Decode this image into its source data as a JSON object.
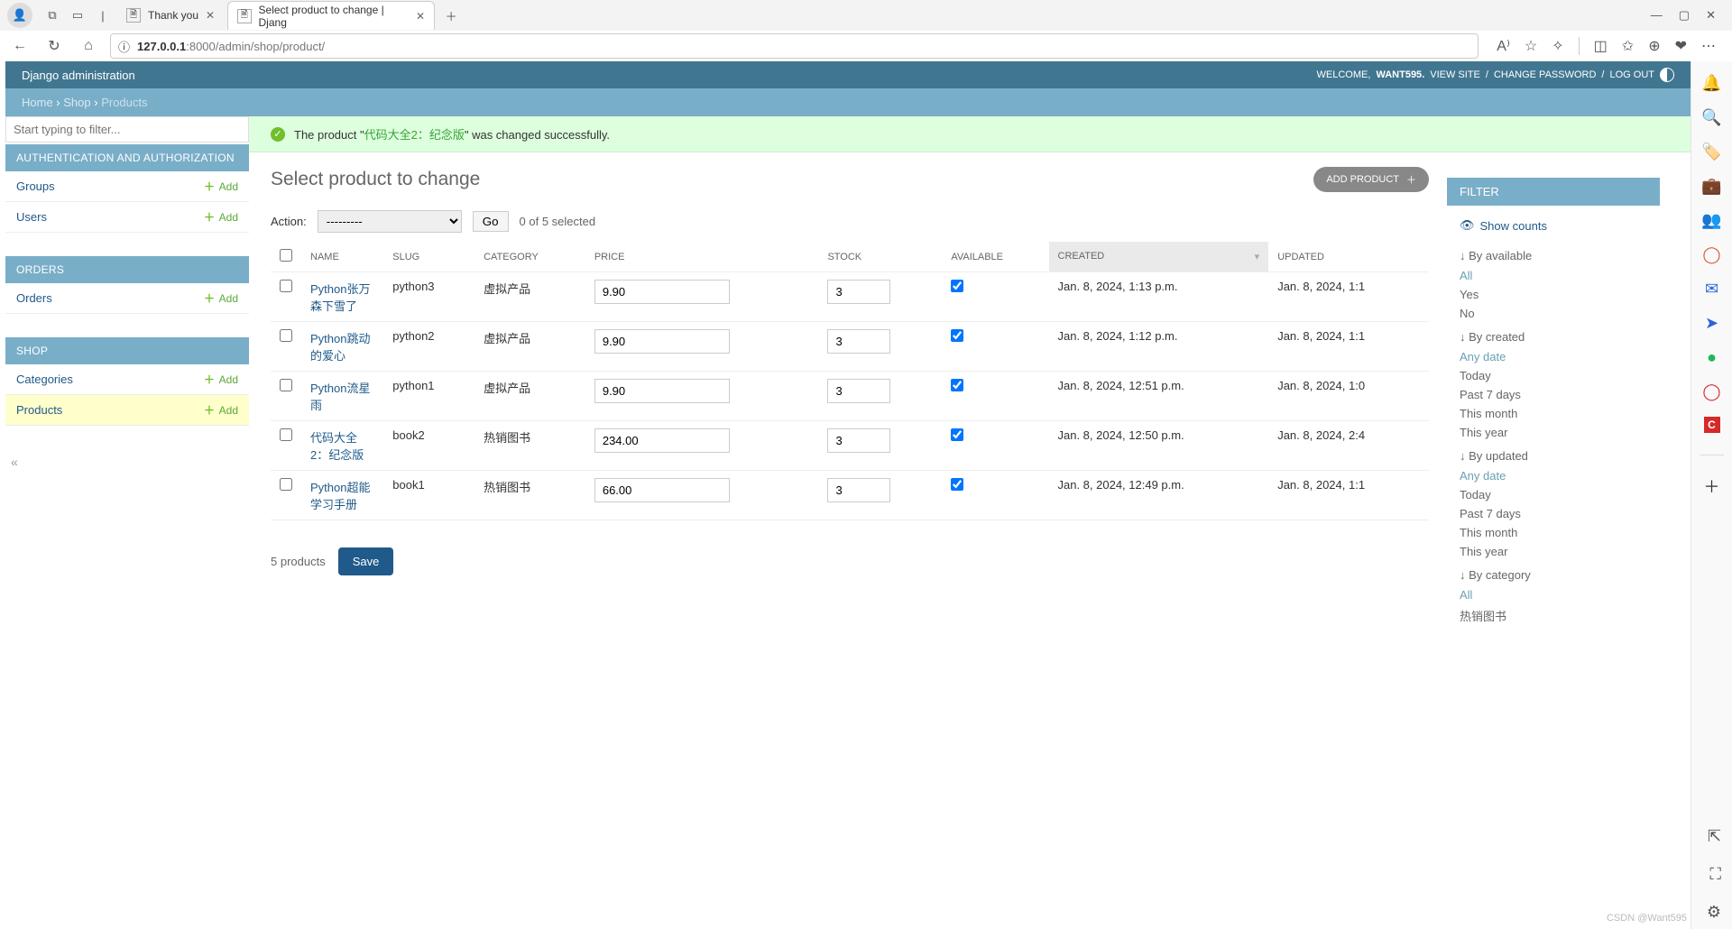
{
  "browser": {
    "tabs": [
      {
        "title": "Thank you",
        "active": false
      },
      {
        "title": "Select product to change | Djang",
        "active": true
      }
    ],
    "url": "127.0.0.1:8000/admin/shop/product/",
    "url_prefix": "127.0.0.1",
    "url_rest": ":8000/admin/shop/product/"
  },
  "header": {
    "site_title": "Django administration",
    "welcome": "WELCOME,",
    "username": "WANT595",
    "links": {
      "view_site": "VIEW SITE",
      "change_password": "CHANGE PASSWORD",
      "logout": "LOG OUT"
    }
  },
  "breadcrumbs": {
    "home": "Home",
    "shop": "Shop",
    "products": "Products"
  },
  "sidebar": {
    "filter_placeholder": "Start typing to filter...",
    "sections": [
      {
        "title": "AUTHENTICATION AND AUTHORIZATION",
        "items": [
          {
            "label": "Groups",
            "add": "Add"
          },
          {
            "label": "Users",
            "add": "Add"
          }
        ]
      },
      {
        "title": "ORDERS",
        "items": [
          {
            "label": "Orders",
            "add": "Add"
          }
        ]
      },
      {
        "title": "SHOP",
        "items": [
          {
            "label": "Categories",
            "add": "Add"
          },
          {
            "label": "Products",
            "add": "Add",
            "selected": true
          }
        ]
      }
    ]
  },
  "message": {
    "prefix": "The product \"",
    "name": "代码大全2：纪念版",
    "suffix": "\" was changed successfully."
  },
  "page": {
    "title": "Select product to change",
    "add_button": "ADD PRODUCT"
  },
  "actions": {
    "label": "Action:",
    "placeholder": "---------",
    "go": "Go",
    "selection": "0 of 5 selected"
  },
  "columns": {
    "name": "NAME",
    "slug": "SLUG",
    "category": "CATEGORY",
    "price": "PRICE",
    "stock": "STOCK",
    "available": "AVAILABLE",
    "created": "CREATED",
    "updated": "UPDATED"
  },
  "rows": [
    {
      "name": "Python张万森下雪了",
      "slug": "python3",
      "category": "虚拟产品",
      "price": "9.90",
      "stock": "3",
      "available": true,
      "created": "Jan. 8, 2024, 1:13 p.m.",
      "updated": "Jan. 8, 2024, 1:1"
    },
    {
      "name": "Python跳动的爱心",
      "slug": "python2",
      "category": "虚拟产品",
      "price": "9.90",
      "stock": "3",
      "available": true,
      "created": "Jan. 8, 2024, 1:12 p.m.",
      "updated": "Jan. 8, 2024, 1:1"
    },
    {
      "name": "Python流星雨",
      "slug": "python1",
      "category": "虚拟产品",
      "price": "9.90",
      "stock": "3",
      "available": true,
      "created": "Jan. 8, 2024, 12:51 p.m.",
      "updated": "Jan. 8, 2024, 1:0"
    },
    {
      "name": "代码大全2：纪念版",
      "slug": "book2",
      "category": "热销图书",
      "price": "234.00",
      "stock": "3",
      "available": true,
      "created": "Jan. 8, 2024, 12:50 p.m.",
      "updated": "Jan. 8, 2024, 2:4"
    },
    {
      "name": "Python超能学习手册",
      "slug": "book1",
      "category": "热销图书",
      "price": "66.00",
      "stock": "3",
      "available": true,
      "created": "Jan. 8, 2024, 12:49 p.m.",
      "updated": "Jan. 8, 2024, 1:1"
    }
  ],
  "paginator": {
    "count": "5 products",
    "save": "Save"
  },
  "filter": {
    "title": "FILTER",
    "show_counts": "Show counts",
    "groups": [
      {
        "label": "By available",
        "options": [
          "All",
          "Yes",
          "No"
        ],
        "selected": "All"
      },
      {
        "label": "By created",
        "options": [
          "Any date",
          "Today",
          "Past 7 days",
          "This month",
          "This year"
        ],
        "selected": "Any date"
      },
      {
        "label": "By updated",
        "options": [
          "Any date",
          "Today",
          "Past 7 days",
          "This month",
          "This year"
        ],
        "selected": "Any date"
      },
      {
        "label": "By category",
        "options": [
          "All",
          "热销图书"
        ],
        "selected": "All"
      }
    ]
  },
  "watermark": "CSDN @Want595"
}
